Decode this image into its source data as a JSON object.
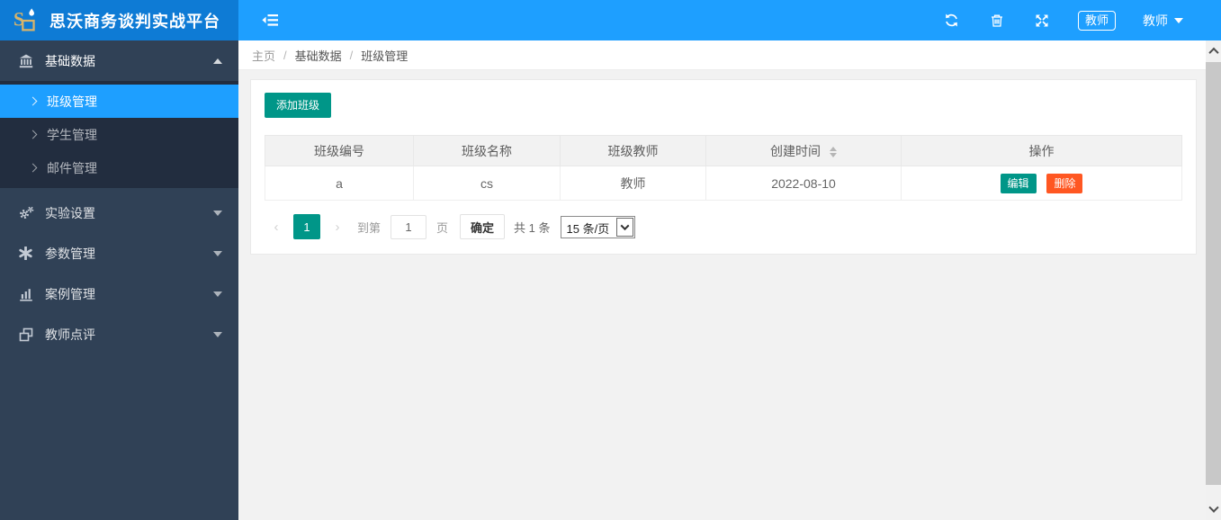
{
  "app": {
    "title": "思沃商务谈判实战平台"
  },
  "header": {
    "icons": {
      "collapse": "flexible-menu-icon",
      "refresh": "refresh-icon",
      "clear": "trash-icon",
      "fullscreen": "fullscreen-icon"
    },
    "role_badge": "教师",
    "user_name": "教师"
  },
  "sidebar": {
    "items": [
      {
        "icon": "bank-icon",
        "label": "基础数据",
        "state": "expanded",
        "children": [
          {
            "label": "班级管理",
            "active": true
          },
          {
            "label": "学生管理",
            "active": false
          },
          {
            "label": "邮件管理",
            "active": false
          }
        ]
      },
      {
        "icon": "cogs-icon",
        "label": "实验设置",
        "state": "collapsed"
      },
      {
        "icon": "asterisk-icon",
        "label": "参数管理",
        "state": "collapsed"
      },
      {
        "icon": "bar-chart-icon",
        "label": "案例管理",
        "state": "collapsed"
      },
      {
        "icon": "windows-icon",
        "label": "教师点评",
        "state": "collapsed"
      }
    ]
  },
  "breadcrumb": {
    "separator": "/",
    "items": [
      "主页",
      "基础数据",
      "班级管理"
    ]
  },
  "content": {
    "add_button": "添加班级",
    "table": {
      "columns": [
        "班级编号",
        "班级名称",
        "班级教师",
        "创建时间",
        "操作"
      ],
      "sortable_column": "创建时间",
      "rows": [
        {
          "class_id": "a",
          "class_name": "cs",
          "teacher": "教师",
          "created": "2022-08-10",
          "actions": {
            "edit": "编辑",
            "delete": "删除"
          }
        }
      ]
    },
    "pagination": {
      "prev": "‹",
      "current_page": "1",
      "next": "›",
      "goto_prefix": "到第",
      "goto_value": "1",
      "goto_suffix": "页",
      "confirm": "确定",
      "total": "共 1 条",
      "page_size": "15 条/页"
    }
  },
  "colors": {
    "header_blue": "#1E9FFF",
    "logo_blue": "#0e7bd5",
    "sidebar_dark": "#304156",
    "submenu_dark": "#222d3f",
    "active_blue": "#1E9FFF",
    "green": "#009688",
    "orange": "#FF5722"
  }
}
